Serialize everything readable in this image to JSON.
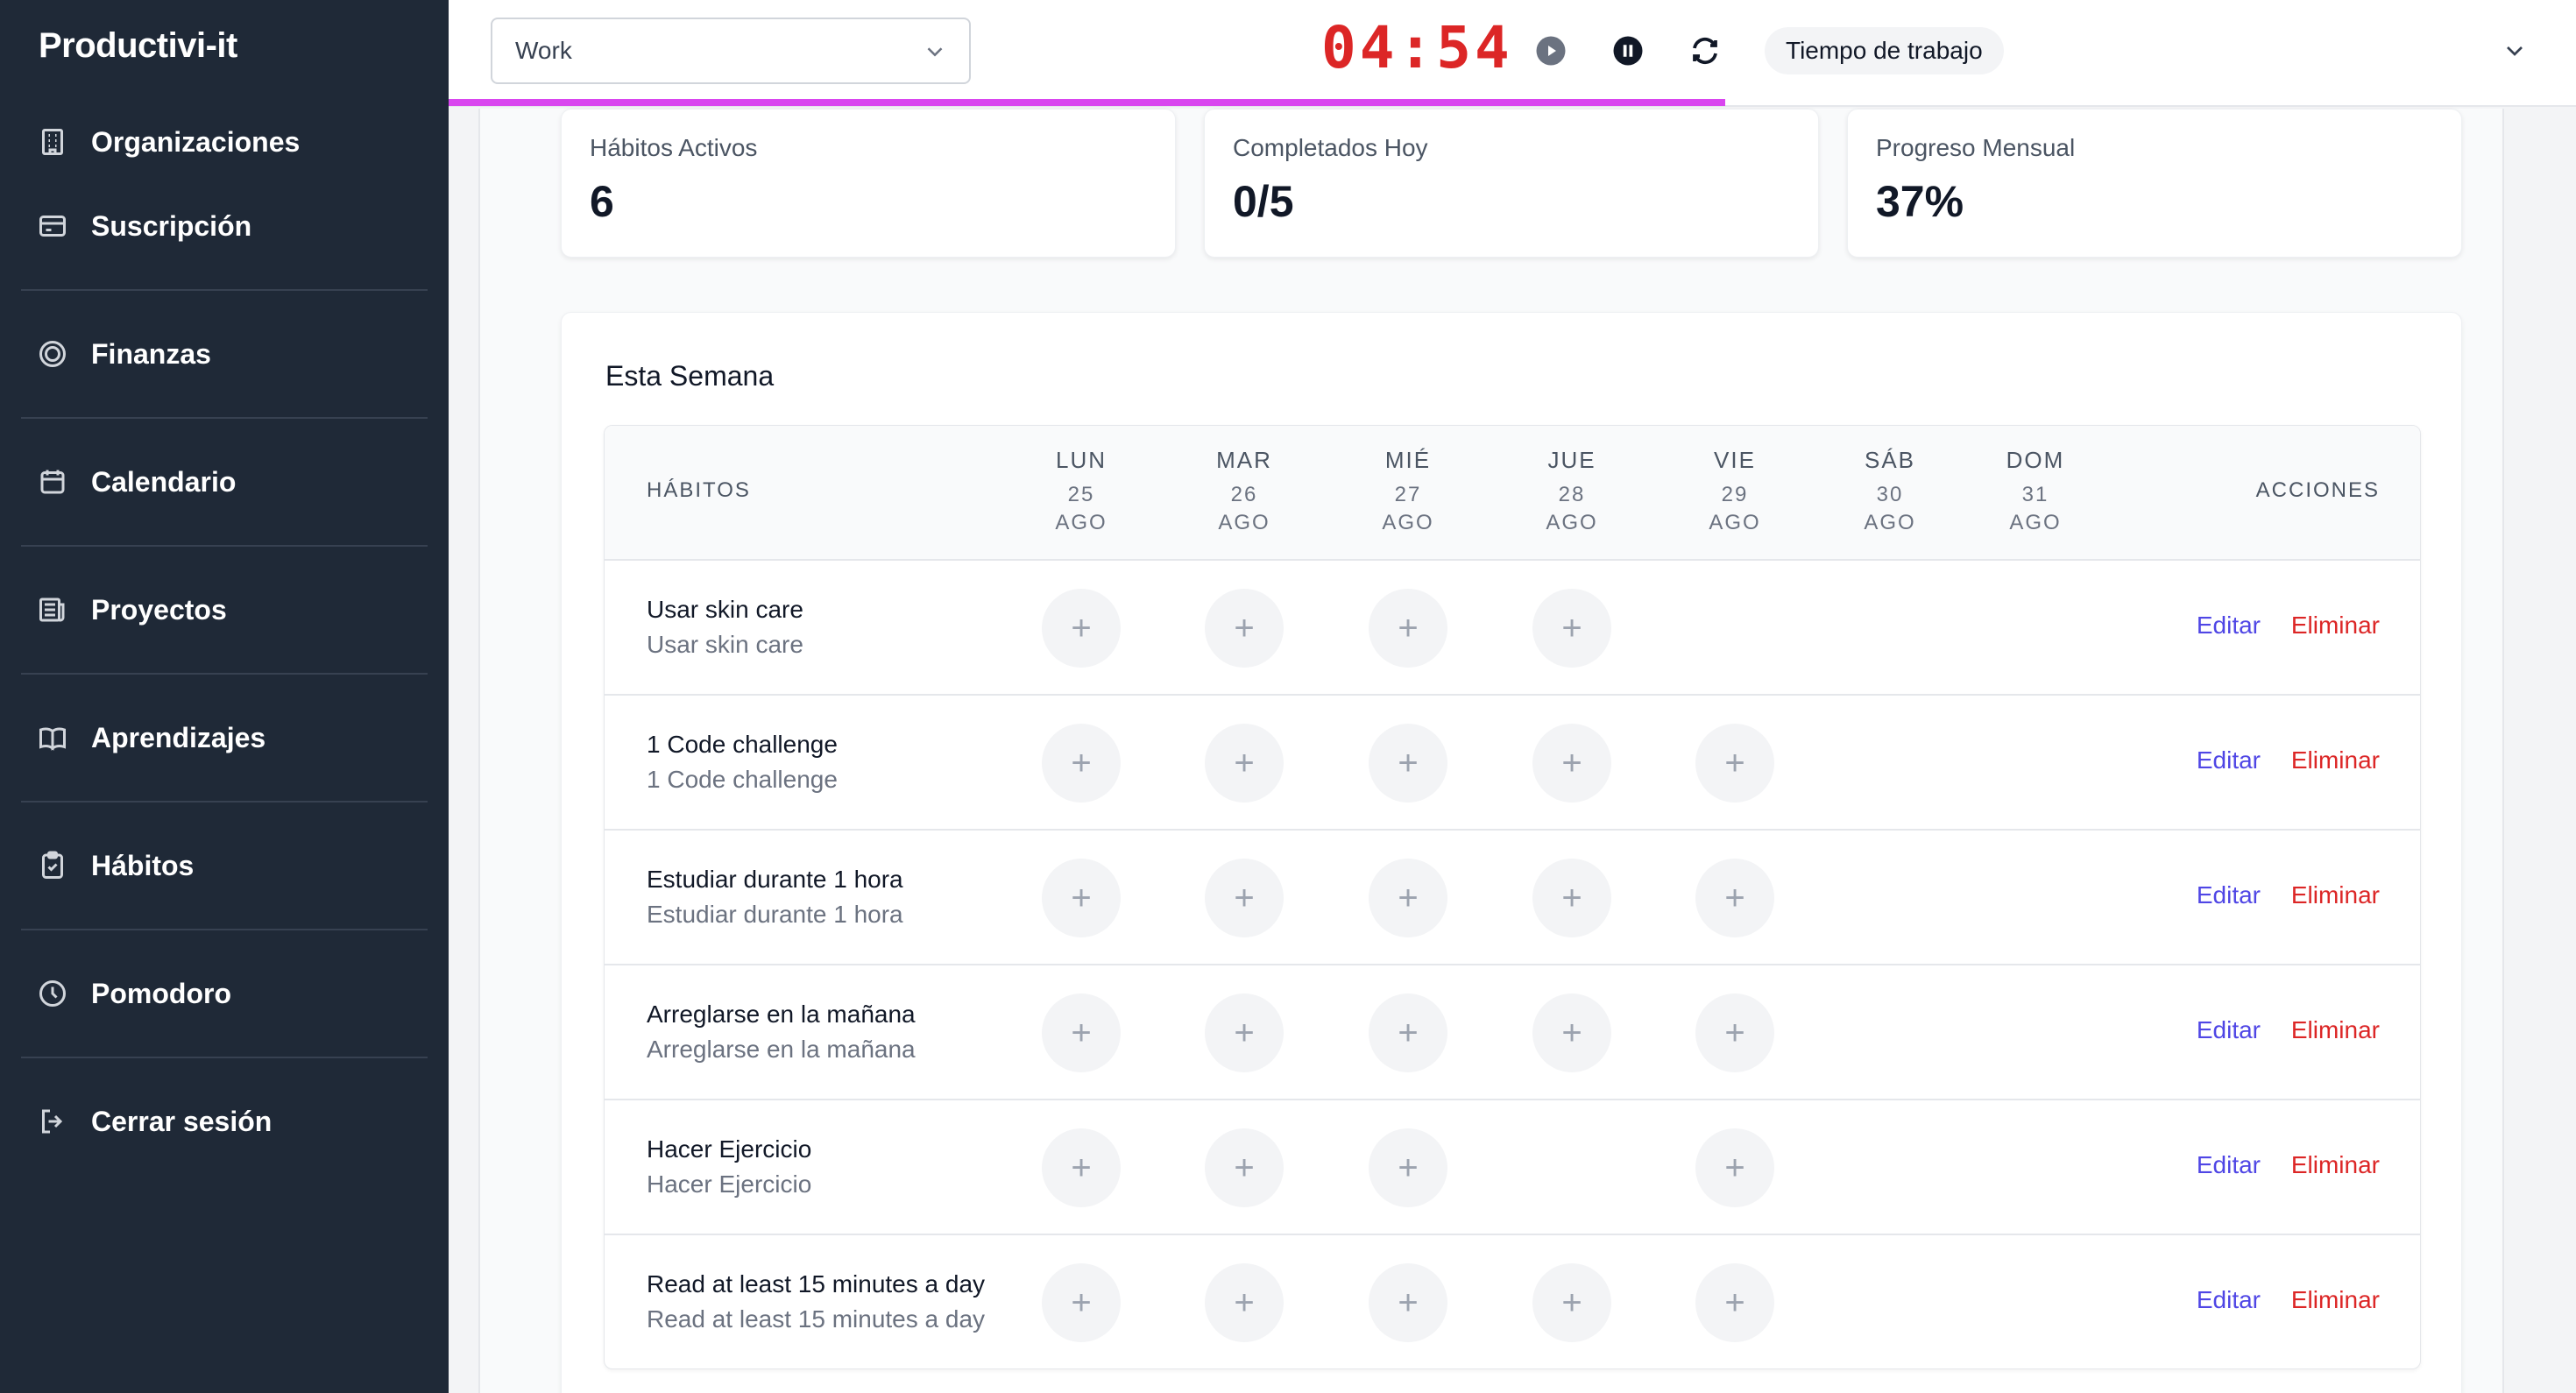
{
  "app": {
    "brand": "Productivi-it"
  },
  "sidebar": {
    "items": [
      {
        "label": "Organizaciones",
        "icon": "building-icon"
      },
      {
        "label": "Suscripción",
        "icon": "credit-card-icon"
      },
      {
        "label": "Finanzas",
        "icon": "target-icon"
      },
      {
        "label": "Calendario",
        "icon": "calendar-icon"
      },
      {
        "label": "Proyectos",
        "icon": "newspaper-icon"
      },
      {
        "label": "Aprendizajes",
        "icon": "book-icon"
      },
      {
        "label": "Hábitos",
        "icon": "clipboard-check-icon"
      },
      {
        "label": "Pomodoro",
        "icon": "clock-icon"
      },
      {
        "label": "Cerrar sesión",
        "icon": "logout-icon"
      }
    ]
  },
  "header": {
    "project_select": "Work",
    "timer": "04:54",
    "mode": "Tiempo de trabajo",
    "timer_progress": 0.6
  },
  "stats": [
    {
      "label": "Hábitos Activos",
      "value": "6"
    },
    {
      "label": "Completados Hoy",
      "value": "0/5"
    },
    {
      "label": "Progreso Mensual",
      "value": "37%"
    }
  ],
  "week": {
    "title": "Esta Semana",
    "habits_header": "HÁBITOS",
    "actions_header": "ACCIONES",
    "days": [
      {
        "name": "LUN",
        "date": "25",
        "month": "AGO"
      },
      {
        "name": "MAR",
        "date": "26",
        "month": "AGO"
      },
      {
        "name": "MIÉ",
        "date": "27",
        "month": "AGO"
      },
      {
        "name": "JUE",
        "date": "28",
        "month": "AGO"
      },
      {
        "name": "VIE",
        "date": "29",
        "month": "AGO"
      },
      {
        "name": "SÁB",
        "date": "30",
        "month": "AGO"
      },
      {
        "name": "DOM",
        "date": "31",
        "month": "AGO"
      }
    ],
    "edit_label": "Editar",
    "delete_label": "Eliminar",
    "plus_symbol": "+",
    "habits": [
      {
        "title": "Usar skin care",
        "subtitle": "Usar skin care",
        "days": [
          1,
          1,
          1,
          1,
          0,
          0,
          0
        ]
      },
      {
        "title": "1 Code challenge",
        "subtitle": "1 Code challenge",
        "days": [
          1,
          1,
          1,
          1,
          1,
          0,
          0
        ]
      },
      {
        "title": "Estudiar durante 1 hora",
        "subtitle": "Estudiar durante 1 hora",
        "days": [
          1,
          1,
          1,
          1,
          1,
          0,
          0
        ]
      },
      {
        "title": "Arreglarse en la mañana",
        "subtitle": "Arreglarse en la mañana",
        "days": [
          1,
          1,
          1,
          1,
          1,
          0,
          0
        ]
      },
      {
        "title": "Hacer Ejercicio",
        "subtitle": "Hacer Ejercicio",
        "days": [
          1,
          1,
          1,
          0,
          1,
          0,
          0
        ]
      },
      {
        "title": "Read at least 15 minutes a day",
        "subtitle": "Read at least 15 minutes a day",
        "days": [
          1,
          1,
          1,
          1,
          1,
          0,
          0
        ]
      }
    ]
  },
  "colors": {
    "sidebar_bg": "#1f2937",
    "timer": "#dc2626",
    "progress": "#d946ef",
    "edit": "#4f46e5",
    "delete": "#dc2626"
  }
}
